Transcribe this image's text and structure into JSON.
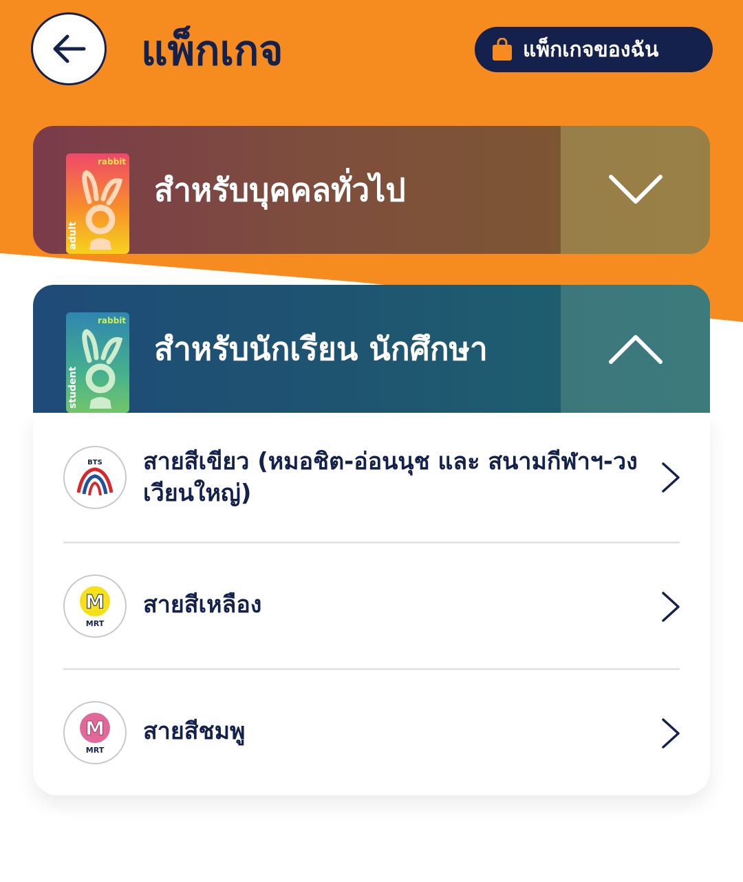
{
  "header": {
    "title": "แพ็กเกจ",
    "my_packages_label": "แพ็กเกจของฉัน"
  },
  "sections": [
    {
      "title": "สำหรับบุคคลทั่วไป",
      "card_label": "adult",
      "card_brand": "rabbit",
      "expanded": false
    },
    {
      "title": "สำหรับนักเรียน นักศึกษา",
      "card_label": "student",
      "card_brand": "rabbit",
      "expanded": true,
      "items": [
        {
          "label": "สายสีเขียว (หมอชิต-อ่อนนุช และ สนามกีฬาฯ-วงเวียนใหญ่)",
          "logo": "bts-logo",
          "logo_text": "BTS"
        },
        {
          "label": "สายสีเหลือง",
          "logo": "mrt-yellow-logo",
          "logo_text": "MRT"
        },
        {
          "label": "สายสีชมพู",
          "logo": "mrt-pink-logo",
          "logo_text": "MRT"
        }
      ]
    }
  ],
  "colors": {
    "orange": "#f68b1f",
    "navy": "#14214d",
    "mrt_yellow": "#f5e01a",
    "mrt_pink": "#e0699a"
  }
}
